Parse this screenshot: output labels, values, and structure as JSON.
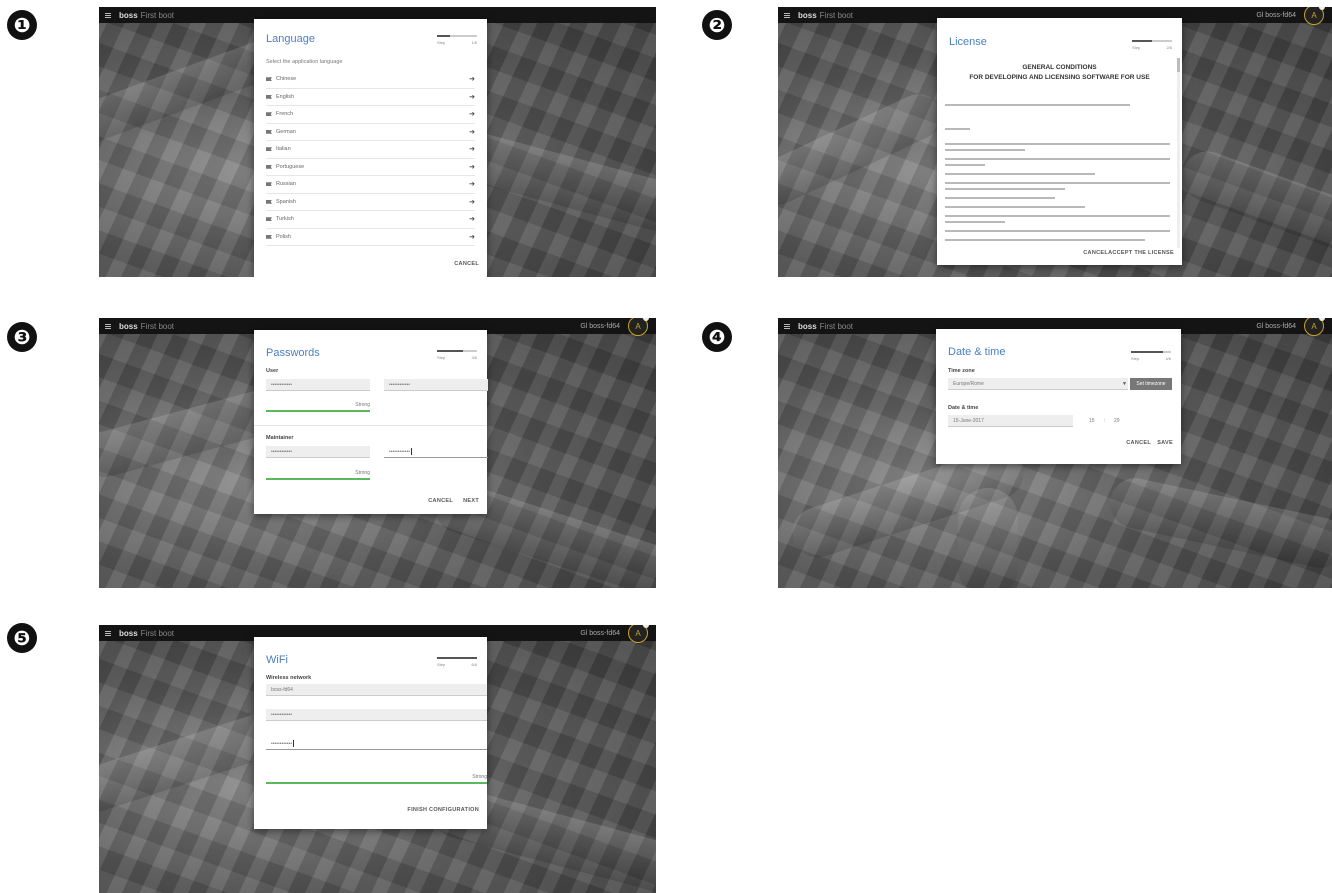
{
  "topbar": {
    "app_title": "boss",
    "app_subtitle": "First boot",
    "device": "Gl boss-fd64",
    "avatar": "A"
  },
  "steps": [
    "❶",
    "❷",
    "❸",
    "❹",
    "❺"
  ],
  "step1": {
    "title": "Language",
    "progress": {
      "left": "Step",
      "right": "1/6",
      "fraction": 0.33
    },
    "subtitle": "Select the application language",
    "languages": [
      "Chinese",
      "English",
      "French",
      "German",
      "Italian",
      "Portuguese",
      "Russian",
      "Spanish",
      "Turkish",
      "Polish"
    ],
    "cancel": "CANCEL"
  },
  "step2": {
    "title": "License",
    "progress": {
      "left": "Step",
      "right": "2/6",
      "fraction": 0.5
    },
    "heading1": "GENERAL CONDITIONS",
    "heading2": "FOR DEVELOPING AND LICENSING SOFTWARE FOR USE",
    "cancel": "CANCEL",
    "accept": "ACCEPT THE LICENSE"
  },
  "step3": {
    "title": "Passwords",
    "progress": {
      "left": "Step",
      "right": "3/6",
      "fraction": 0.66
    },
    "user_label": "User",
    "maintainer_label": "Maintainer",
    "masked": "••••••••••••",
    "strength": "Strong",
    "cancel": "CANCEL",
    "next": "NEXT"
  },
  "step4": {
    "title": "Date & time",
    "progress": {
      "left": "Step",
      "right": "4/6",
      "fraction": 0.8
    },
    "timezone_label": "Time zone",
    "timezone_value": "Europe/Rome",
    "set_timezone": "Set timezone",
    "datetime_label": "Date & time",
    "date_value": "15-June-2017",
    "hour": "15",
    "sep": ":",
    "minute": "29",
    "cancel": "CANCEL",
    "save": "SAVE"
  },
  "step5": {
    "title": "WiFi",
    "progress": {
      "left": "Step",
      "right": "6/6",
      "fraction": 1.0
    },
    "network_label": "Wireless network",
    "network_value": "boss-fd64",
    "masked": "••••••••••••",
    "strength": "Strong",
    "finish": "FINISH CONFIGURATION"
  }
}
